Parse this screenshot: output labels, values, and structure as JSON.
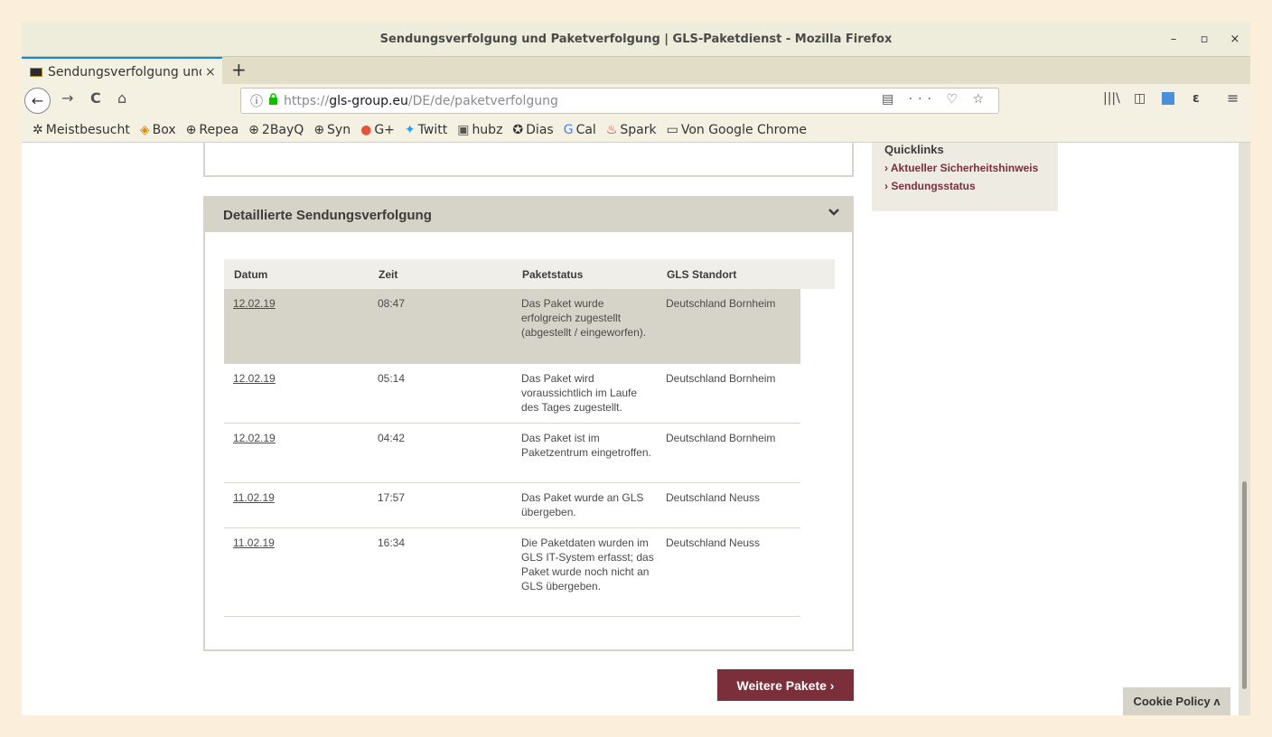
{
  "window": {
    "title": "Sendungsverfolgung und Paketverfolgung | GLS-Paketdienst - Mozilla Firefox",
    "controls": {
      "minimize": "–",
      "maximize": "▫",
      "close": "×"
    }
  },
  "tab": {
    "title": "Sendungsverfolgung und",
    "close": "×",
    "new_tab": "+"
  },
  "nav": {
    "back": "←",
    "forward": "→",
    "reload": "C",
    "home": "⌂",
    "url_info_icon": "ⓘ",
    "url_lock_icon": "lock",
    "url_scheme": "https://",
    "url_host": "gls-group.eu",
    "url_path": "/DE/de/paketverfolgung",
    "url_actions": "▤ ··· ♡ ☆",
    "library": "|||\\",
    "sidebar": "◫",
    "menu": "≡"
  },
  "bookmarks": [
    {
      "icon": "✲",
      "label": "Meistbesucht"
    },
    {
      "icon": "◈",
      "label": "Box"
    },
    {
      "icon": "⊕",
      "label": "Repea"
    },
    {
      "icon": "⊕",
      "label": "2BayQ"
    },
    {
      "icon": "⊕",
      "label": "Syn"
    },
    {
      "icon": "●",
      "label": "G+"
    },
    {
      "icon": "✦",
      "label": "Twitt"
    },
    {
      "icon": "▣",
      "label": "hubz"
    },
    {
      "icon": "✪",
      "label": "Dias"
    },
    {
      "icon": "G",
      "label": "Cal"
    },
    {
      "icon": "♨",
      "label": "Spark"
    },
    {
      "icon": "▭",
      "label": "Von Google Chrome"
    }
  ],
  "panel": {
    "title": "Detaillierte Sendungsverfolgung",
    "chevron": "⌄"
  },
  "table": {
    "headers": [
      "Datum",
      "Zeit",
      "Paketstatus",
      "GLS Standort"
    ],
    "rows": [
      {
        "date": "12.02.19",
        "time": "08:47",
        "status": "Das Paket wurde erfolgreich zugestellt (abgestellt / eingeworfen).",
        "location": "Deutschland Bornheim"
      },
      {
        "date": "12.02.19",
        "time": "05:14",
        "status": "Das Paket wird voraussichtlich im Laufe des Tages zugestellt.",
        "location": "Deutschland Bornheim"
      },
      {
        "date": "12.02.19",
        "time": "04:42",
        "status": "Das Paket ist im Paketzentrum eingetroffen.",
        "location": "Deutschland Bornheim"
      },
      {
        "date": "11.02.19",
        "time": "17:57",
        "status": "Das Paket wurde an GLS übergeben.",
        "location": "Deutschland Neuss"
      },
      {
        "date": "11.02.19",
        "time": "16:34",
        "status": "Die Paketdaten wurden im GLS IT-System erfasst; das Paket wurde noch nicht an GLS übergeben.",
        "location": "Deutschland Neuss"
      }
    ]
  },
  "more_button": "Weitere Pakete  ›",
  "quicklinks": {
    "title": "Quicklinks",
    "links": [
      "› Aktueller Sicherheitshinweis",
      "› Sendungsstatus"
    ]
  },
  "cookie": "Cookie Policy  ʌ",
  "colors": {
    "brand": "#7b2f3a",
    "panel_gray": "#d6d3c9",
    "desktop": "#fbefdc"
  }
}
